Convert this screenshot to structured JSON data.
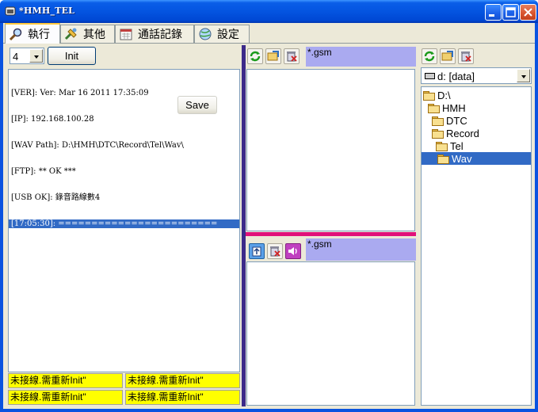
{
  "window": {
    "title": "*HMH_TEL"
  },
  "tabs": [
    {
      "label": "執行",
      "icon": "magnifier-icon"
    },
    {
      "label": "其他",
      "icon": "tools-icon"
    },
    {
      "label": "通話記錄",
      "icon": "calendar-icon"
    },
    {
      "label": "設定",
      "icon": "globe-icon"
    }
  ],
  "left": {
    "line_select": "4",
    "init_label": "Init",
    "save_label": "Save",
    "log": [
      "[VER]: Ver: Mar 16 2011 17:35:09",
      "[IP]: 192.168.100.28",
      "[WAV Path]: D:\\HMH\\DTC\\Record\\Tel\\Wav\\",
      "[FTP]: ** OK ***",
      "[USB OK]: 錄音路線數4",
      "[17:05:30]: ========================"
    ],
    "status": [
      "未接線.需重新Init\"",
      "未接線.需重新Init\"",
      "未接線.需重新Init\"",
      "未接線.需重新Init\""
    ]
  },
  "middle": {
    "top_filter": "*.gsm",
    "bottom_filter": "*.gsm"
  },
  "right": {
    "drive": "d: [data]",
    "tree": [
      {
        "label": "D:\\",
        "level": 0
      },
      {
        "label": "HMH",
        "level": 1
      },
      {
        "label": "DTC",
        "level": 2
      },
      {
        "label": "Record",
        "level": 3
      },
      {
        "label": "Tel",
        "level": 4
      },
      {
        "label": "Wav",
        "level": 5
      }
    ]
  },
  "colors": {
    "titlebar": "#0454e0",
    "selection": "#316ac5",
    "status_bg": "#ffff00",
    "filter_bg": "#aaaaf0",
    "splitter": "#3c2a8a",
    "pink_bar": "#e0107a"
  }
}
